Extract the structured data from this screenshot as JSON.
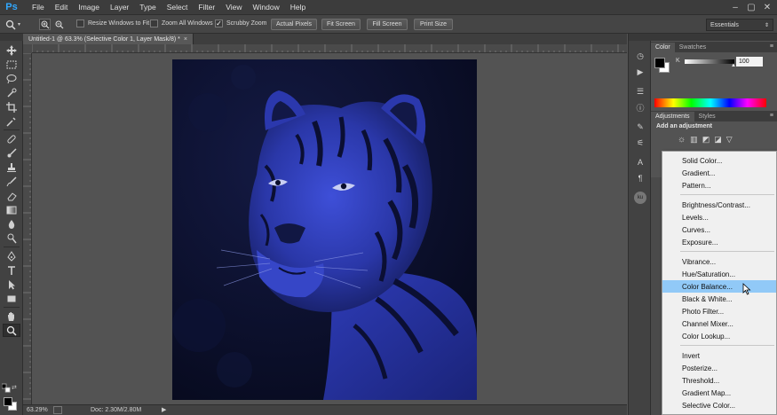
{
  "app": {
    "logo": "Ps"
  },
  "menubar": {
    "items": [
      "File",
      "Edit",
      "Image",
      "Layer",
      "Type",
      "Select",
      "Filter",
      "View",
      "Window",
      "Help"
    ]
  },
  "options": {
    "resize_windows": "Resize Windows to Fit",
    "zoom_all": "Zoom All Windows",
    "scrubby_zoom": "Scrubby Zoom",
    "actual_pixels": "Actual Pixels",
    "fit_screen": "Fit Screen",
    "fill_screen": "Fill Screen",
    "print_size": "Print Size",
    "workspace": "Essentials"
  },
  "document": {
    "tab_title": "Untitled-1 @ 63.3% (Selective Color 1, Layer Mask/8) *",
    "close": "×"
  },
  "status": {
    "zoom": "63.29%",
    "doc_info": "Doc: 2.30M/2.80M"
  },
  "color_panel": {
    "tabs": [
      "Color",
      "Swatches"
    ],
    "channel": "K",
    "value": "100"
  },
  "adjustments_panel": {
    "tabs": [
      "Adjustments",
      "Styles"
    ],
    "heading": "Add an adjustment"
  },
  "adjustment_menu": {
    "groups": [
      [
        "Solid Color...",
        "Gradient...",
        "Pattern..."
      ],
      [
        "Brightness/Contrast...",
        "Levels...",
        "Curves...",
        "Exposure..."
      ],
      [
        "Vibrance...",
        "Hue/Saturation...",
        "Color Balance...",
        "Black & White...",
        "Photo Filter...",
        "Channel Mixer...",
        "Color Lookup..."
      ],
      [
        "Invert",
        "Posterize...",
        "Threshold...",
        "Gradient Map...",
        "Selective Color..."
      ]
    ],
    "highlighted": "Color Balance..."
  },
  "colors": {
    "accent_blue": "#31a8ff",
    "menu_highlight": "#91c9f7",
    "canvas_tint": "#2a3bb8"
  }
}
